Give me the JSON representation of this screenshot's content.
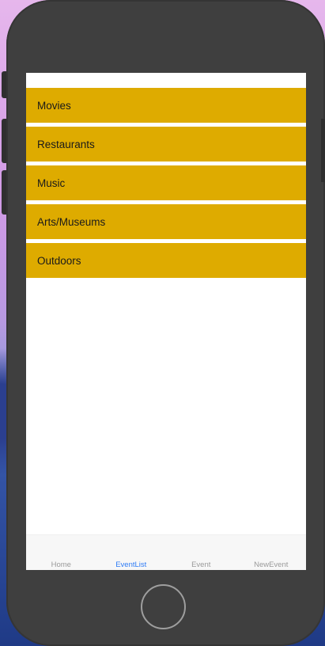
{
  "categories": [
    {
      "label": "Movies"
    },
    {
      "label": "Restaurants"
    },
    {
      "label": "Music"
    },
    {
      "label": "Arts/Museums"
    },
    {
      "label": "Outdoors"
    }
  ],
  "tabbar": {
    "tabs": [
      {
        "label": "Home",
        "active": false
      },
      {
        "label": "EventList",
        "active": true
      },
      {
        "label": "Event",
        "active": false
      },
      {
        "label": "NewEvent",
        "active": false
      }
    ],
    "active_color": "#2f7cf6",
    "inactive_color": "#9a9a9a"
  },
  "colors": {
    "row_background": "#deab00",
    "screen_background": "#ffffff",
    "phone_body": "#3f3f3f"
  }
}
